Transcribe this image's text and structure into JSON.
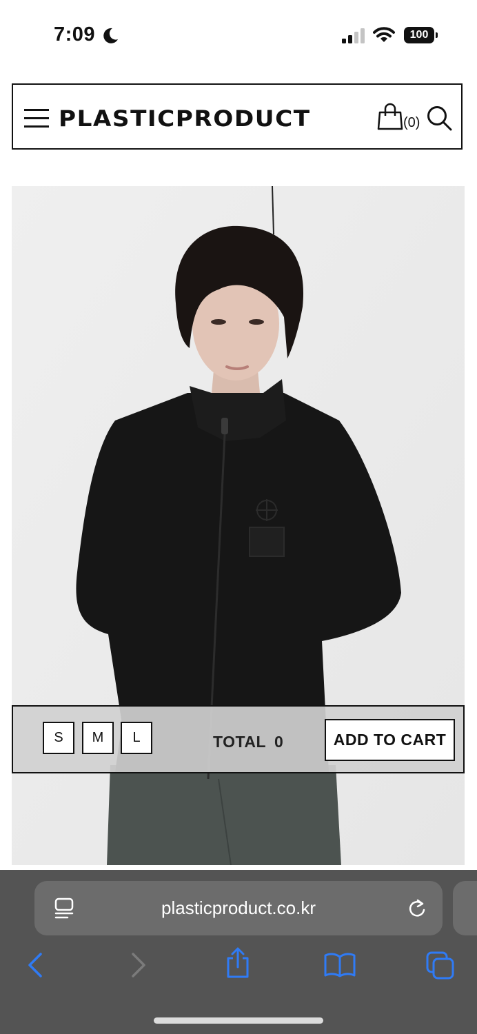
{
  "status_bar": {
    "time": "7:09",
    "battery": "100"
  },
  "header": {
    "brand": "PLASTICPRODUCT",
    "cart_count": "(0)"
  },
  "purchase_bar": {
    "sizes": [
      "S",
      "M",
      "L"
    ],
    "total_label": "TOTAL",
    "total_value": "0",
    "add_to_cart": "ADD TO CART"
  },
  "browser": {
    "url": "plasticproduct.co.kr"
  },
  "colors": {
    "accent": "#2f7bf6",
    "chrome_bg": "#545454",
    "url_field_bg": "#6c6c6c"
  }
}
